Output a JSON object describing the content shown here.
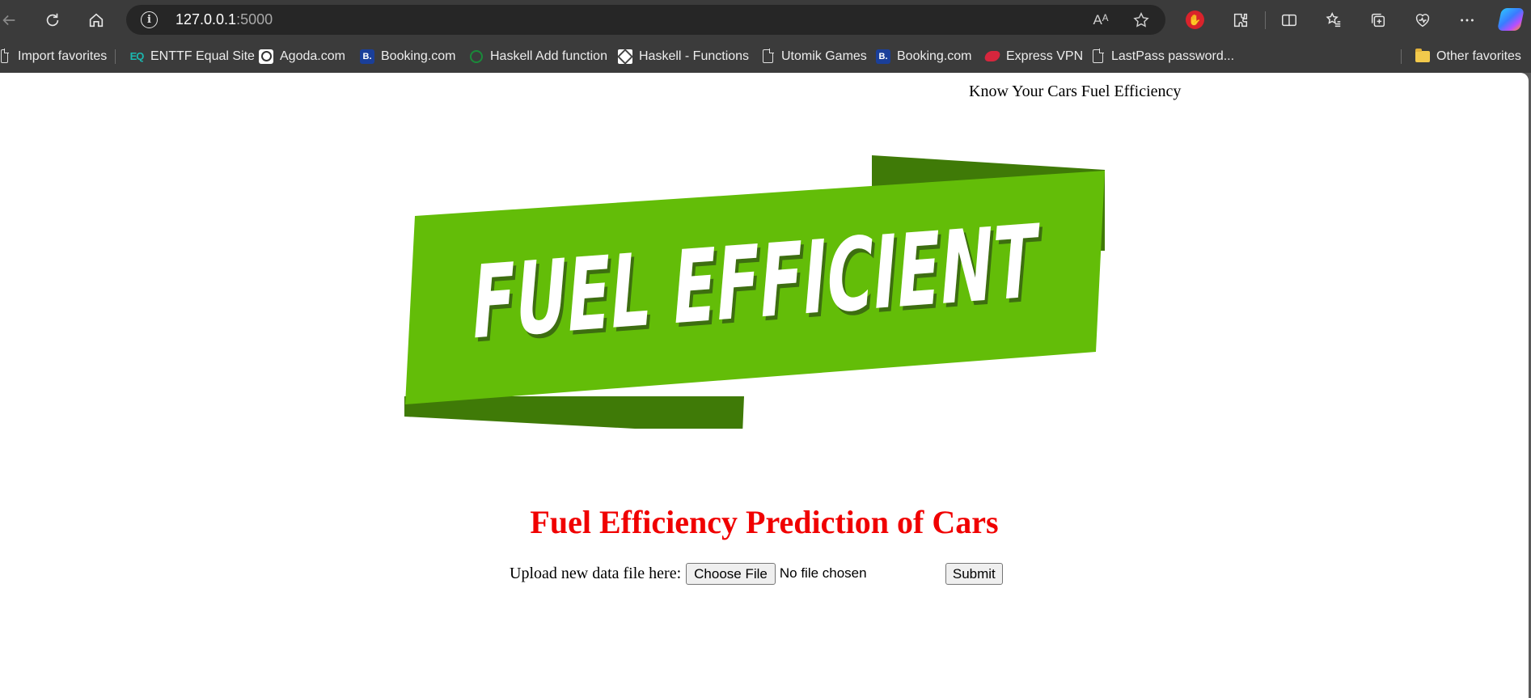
{
  "browser": {
    "url_host": "127.0.0.1",
    "url_port": ":5000",
    "read_aloud_label": "Aᴬ"
  },
  "bookmarks": [
    {
      "label": "Import favorites",
      "icon": "import-icon"
    },
    {
      "label": "ENTTF Equal Site",
      "icon": "eq-icon",
      "icon_text": "EQ"
    },
    {
      "label": "Agoda.com",
      "icon": "agoda-icon"
    },
    {
      "label": "Booking.com",
      "icon": "booking-icon",
      "icon_text": "B."
    },
    {
      "label": "Haskell Add function",
      "icon": "haskell-icon"
    },
    {
      "label": "Haskell - Functions",
      "icon": "haskell-icon"
    },
    {
      "label": "Utomik Games",
      "icon": "page-icon"
    },
    {
      "label": "Booking.com",
      "icon": "booking-icon",
      "icon_text": "B."
    },
    {
      "label": "Express VPN",
      "icon": "vpn-icon"
    },
    {
      "label": "LastPass password...",
      "icon": "page-icon"
    },
    {
      "label": "Other favorites",
      "icon": "folder-icon"
    }
  ],
  "page": {
    "top_heading": "Know Your Cars Fuel Efficiency",
    "banner_text": "FUEL EFFICIENT",
    "title": "Fuel Efficiency Prediction of Cars",
    "upload_label": "Upload new data file here:",
    "choose_file_label": "Choose File",
    "file_status": "No file chosen",
    "submit_label": "Submit"
  },
  "colors": {
    "banner_green": "#63bd08",
    "banner_dark_green": "#3f7a07",
    "title_red": "#f00000"
  }
}
